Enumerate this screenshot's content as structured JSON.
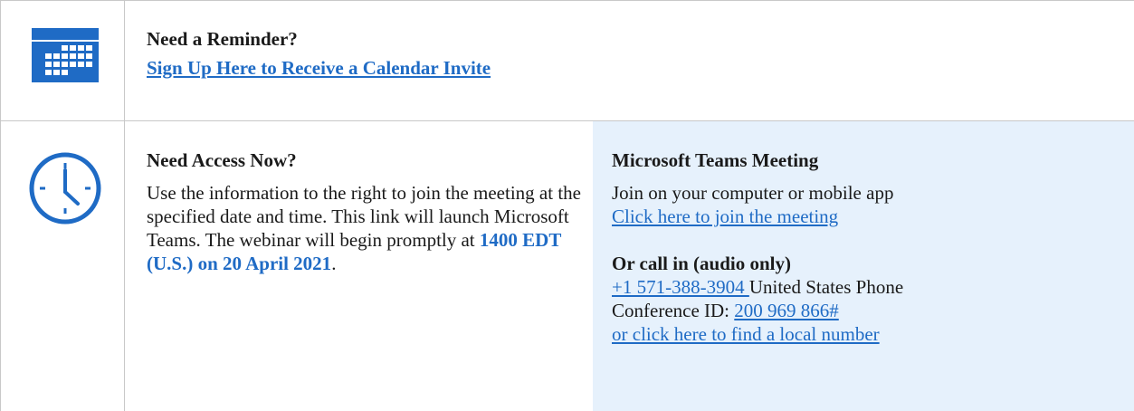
{
  "reminder": {
    "title": "Need a Reminder?",
    "link": "Sign Up Here to Receive a Calendar Invite"
  },
  "access": {
    "title": "Need Access Now?",
    "body": "Use the information to the right to join the meeting at the specified date and time. This link will launch Microsoft Teams. The webinar will begin promptly at ",
    "highlight": "1400 EDT (U.S.) on 20 April 2021",
    "period": "."
  },
  "teams": {
    "title": "Microsoft Teams Meeting",
    "join_text": "Join on your computer or mobile app",
    "join_link": "Click here to join the meeting",
    "call_title": "Or call in (audio only)",
    "phone_link": "+1 571-388-3904 ",
    "phone_suffix": "United States Phone",
    "conf_label": "Conference ID: ",
    "conf_id": "200 969 866#",
    "local_link": "or click here to find a local number"
  },
  "colors": {
    "link": "#1f6bc5",
    "panel_bg": "#e6f1fc",
    "icon": "#1f6bc5",
    "border": "#c8c8c8"
  },
  "icons": [
    "calendar-icon",
    "clock-icon"
  ]
}
